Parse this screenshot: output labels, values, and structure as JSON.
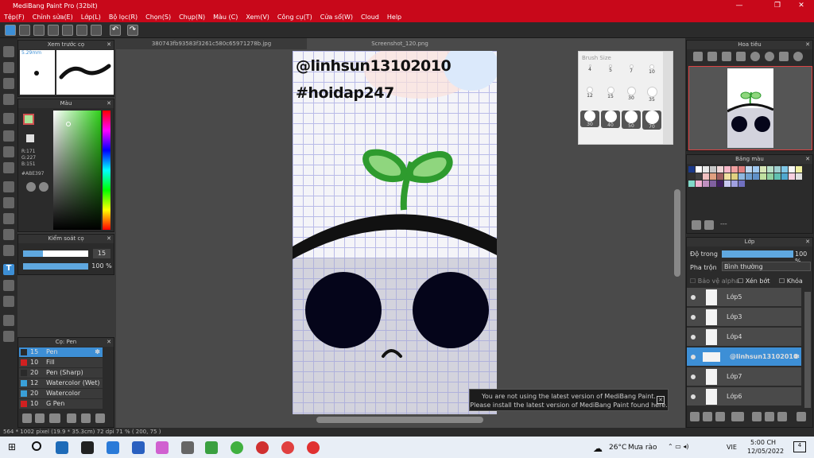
{
  "app": {
    "title": "MediBang Paint Pro (32bit)"
  },
  "menu": [
    "Tệp(F)",
    "Chỉnh sửa(E)",
    "Lớp(L)",
    "Bộ lọc(R)",
    "Chọn(S)",
    "Chụp(N)",
    "Màu (C)",
    "Xem(V)",
    "Công cụ(T)",
    "Cửa sổ(W)",
    "Cloud",
    "Help"
  ],
  "tabs": [
    "380743fb93583f3261c580c65971278b.jpg",
    "Screenshot_120.png"
  ],
  "preview_panel": {
    "title": "Xem trước cọ",
    "size": "5.29mm"
  },
  "color_panel": {
    "title": "Màu",
    "r": "R:171",
    "g": "G:227",
    "b": "B:151",
    "hex": "#ABE397"
  },
  "brush_control": {
    "title": "Kiểm soát cọ",
    "size_value": "15",
    "opacity_value": "100 %"
  },
  "brush_list": {
    "title": "Cọ: Pen",
    "items": [
      {
        "size": "15",
        "name": "Pen",
        "color": "#2a2a2a"
      },
      {
        "size": "10",
        "name": "Fill",
        "color": "#d02020"
      },
      {
        "size": "20",
        "name": "Pen (Sharp)",
        "color": "#2a2a2a"
      },
      {
        "size": "12",
        "name": "Watercolor (Wet)",
        "color": "#3aa0d8"
      },
      {
        "size": "20",
        "name": "Watercolor",
        "color": "#3aa0d8"
      },
      {
        "size": "10",
        "name": "G Pen",
        "color": "#d02020"
      }
    ]
  },
  "canvas": {
    "line1": "@linhsun13102010",
    "line2": "#hoidap247"
  },
  "brush_size": {
    "title": "Brush Size",
    "labels": [
      "4",
      "5",
      "7",
      "10",
      "12",
      "15",
      "30",
      "35",
      "30",
      "40",
      "50",
      "70"
    ]
  },
  "navigator": {
    "title": "Hoa tiêu"
  },
  "palette": {
    "title": "Bảng màu",
    "bottom_label": "---",
    "colors": [
      "#1c3a8a",
      "#ffffff",
      "#e8e8e8",
      "#c8c8c8",
      "#f0d8d8",
      "#f8b8c8",
      "#f0a0a0",
      "#e08080",
      "#c0d8f0",
      "#a0c8f0",
      "#d8e8b8",
      "#b8e0c8",
      "#a0d0d0",
      "#80c8e8",
      "#f8f8f8",
      "#f0f0a0",
      "#303030",
      "#404040",
      "#f0c0c0",
      "#e0a080",
      "#a06060",
      "#f0e0a0",
      "#e0d080",
      "#90b8e0",
      "#70a0d0",
      "#6090c8",
      "#c0e0a0",
      "#90d0a0",
      "#60c0b0",
      "#50a8d0",
      "#f8d0e0",
      "#e0e0e0",
      "#80d8c8",
      "#f0b0d0",
      "#c090c0",
      "#8060a0",
      "#402060",
      "#c8c8f0",
      "#a0a0e0",
      "#7070c0"
    ]
  },
  "layers_panel": {
    "title": "Lớp",
    "opacity_label": "Độ trong",
    "opacity_value": "100 %",
    "blend_label": "Pha trộn",
    "blend_value": "Bình thường",
    "protect_alpha": "Bảo vệ alpha",
    "clipping": "Xén bớt",
    "lock": "Khóa",
    "layers": [
      "Lớp5",
      "Lớp3",
      "Lớp4",
      "@linhsun13102010",
      "Lớp7",
      "Lớp6"
    ]
  },
  "notice": {
    "line1": "You are not using the latest version of MediBang Paint.",
    "line2": "Please install the latest version of MediBang Paint found here."
  },
  "status": {
    "text": "564 * 1002 pixel   (19.9 * 35.3cm)   72 dpi   71 %   ( 200, 75 )"
  },
  "taskbar": {
    "weather_temp": "26°C",
    "weather_text": "Mưa rào",
    "lang": "VIE",
    "time": "5:00 CH",
    "date": "12/05/2022",
    "notif_count": "4"
  },
  "colors": {
    "accent": "#c8081a",
    "selected_layer": "#3d8fd6",
    "stem_green": "#2e9b2e",
    "leaf_green": "#8fd67e"
  }
}
